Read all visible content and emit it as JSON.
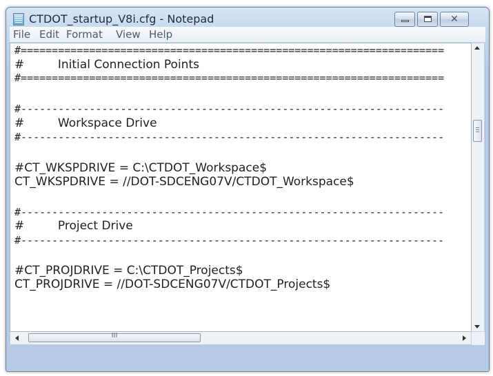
{
  "window": {
    "title": "CTDOT_startup_V8i.cfg - Notepad",
    "close_glyph": "✕"
  },
  "menu": {
    "items": [
      "File",
      "Edit",
      "Format",
      "View",
      "Help"
    ]
  },
  "editor": {
    "lines": [
      "#====================================================================",
      "#         Initial Connection Points",
      "#====================================================================",
      "",
      "#--------------------------------------------------------------------",
      "#         Workspace Drive",
      "#--------------------------------------------------------------------",
      "",
      "#CT_WKSPDRIVE = C:\\CTDOT_Workspace$",
      "CT_WKSPDRIVE = //DOT-SDCENG07V/CTDOT_Workspace$",
      "",
      "#--------------------------------------------------------------------",
      "#         Project Drive",
      "#--------------------------------------------------------------------",
      "",
      "#CT_PROJDRIVE = C:\\CTDOT_Projects$",
      "CT_PROJDRIVE = //DOT-SDCENG07V/CTDOT_Projects$"
    ]
  },
  "scrollbar": {
    "h_thumb_grip": "III"
  }
}
